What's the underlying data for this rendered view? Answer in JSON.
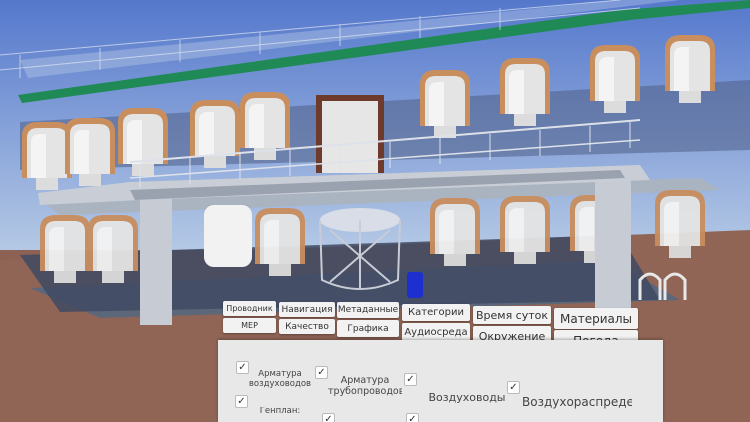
{
  "menu": {
    "row1": [
      "Проводник",
      "Навигация",
      "Метаданные",
      "Категории",
      "Время суток",
      "Материалы"
    ],
    "row2": [
      "MEP",
      "Качество",
      "Графика",
      "Аудиосреда",
      "Окружение",
      "Погода"
    ]
  },
  "panel": {
    "items": [
      {
        "label": "Арматура воздуховодов",
        "checked": true
      },
      {
        "label": "Арматура трубопроводов",
        "checked": true
      },
      {
        "label": "Воздуховоды",
        "checked": true
      },
      {
        "label": "Воздухораспределители",
        "checked": true
      },
      {
        "label": "Генплан:",
        "checked": true
      },
      {
        "label": "",
        "checked": true
      },
      {
        "label": "",
        "checked": true
      }
    ]
  },
  "colors": {
    "sky_top": "#5a7ccc",
    "sky_bottom": "#b6cbe6",
    "ground": "#8c6254",
    "roof": "#1f8a55",
    "door_frame": "#c98e5e",
    "button_bg": "#f2f2f2",
    "panel_bg": "#e8e8e8"
  }
}
